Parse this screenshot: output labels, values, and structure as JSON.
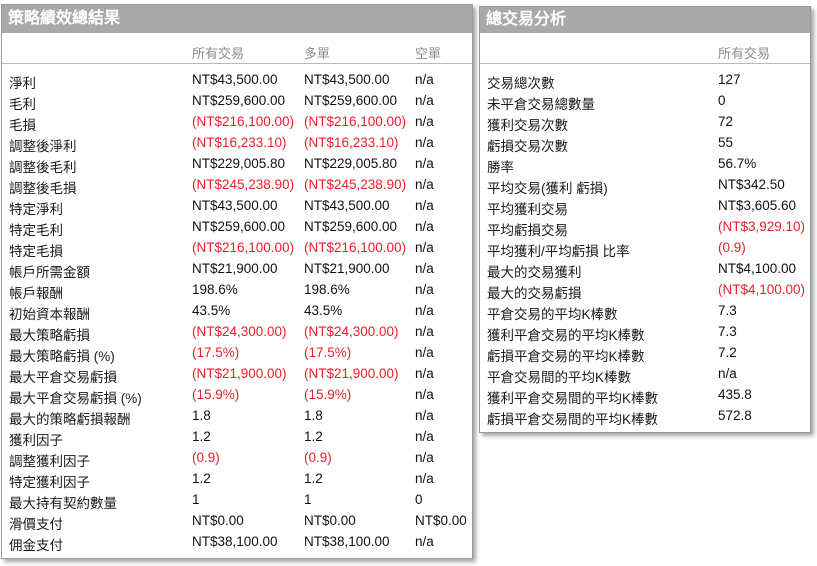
{
  "left_panel": {
    "title": "策略績效總結果",
    "columns": [
      "所有交易",
      "多單",
      "空單"
    ],
    "rows": [
      {
        "label": "淨利",
        "values": [
          "NT$43,500.00",
          "NT$43,500.00",
          "n/a"
        ]
      },
      {
        "label": "毛利",
        "values": [
          "NT$259,600.00",
          "NT$259,600.00",
          "n/a"
        ]
      },
      {
        "label": "毛損",
        "values": [
          "(NT$216,100.00)",
          "(NT$216,100.00)",
          "n/a"
        ]
      },
      {
        "label": "調整後淨利",
        "values": [
          "(NT$16,233.10)",
          "(NT$16,233.10)",
          "n/a"
        ]
      },
      {
        "label": "調整後毛利",
        "values": [
          "NT$229,005.80",
          "NT$229,005.80",
          "n/a"
        ]
      },
      {
        "label": "調整後毛損",
        "values": [
          "(NT$245,238.90)",
          "(NT$245,238.90)",
          "n/a"
        ]
      },
      {
        "label": "特定淨利",
        "values": [
          "NT$43,500.00",
          "NT$43,500.00",
          "n/a"
        ]
      },
      {
        "label": "特定毛利",
        "values": [
          "NT$259,600.00",
          "NT$259,600.00",
          "n/a"
        ]
      },
      {
        "label": "特定毛損",
        "values": [
          "(NT$216,100.00)",
          "(NT$216,100.00)",
          "n/a"
        ]
      },
      {
        "label": "帳戶所需金額",
        "values": [
          "NT$21,900.00",
          "NT$21,900.00",
          "n/a"
        ]
      },
      {
        "label": "帳戶報酬",
        "values": [
          "198.6%",
          "198.6%",
          "n/a"
        ]
      },
      {
        "label": "初始資本報酬",
        "values": [
          "43.5%",
          "43.5%",
          "n/a"
        ]
      },
      {
        "label": "最大策略虧損",
        "values": [
          "(NT$24,300.00)",
          "(NT$24,300.00)",
          "n/a"
        ]
      },
      {
        "label": "最大策略虧損 (%)",
        "values": [
          "(17.5%)",
          "(17.5%)",
          "n/a"
        ]
      },
      {
        "label": "最大平倉交易虧損",
        "values": [
          "(NT$21,900.00)",
          "(NT$21,900.00)",
          "n/a"
        ]
      },
      {
        "label": "最大平倉交易虧損 (%)",
        "values": [
          "(15.9%)",
          "(15.9%)",
          "n/a"
        ]
      },
      {
        "label": "最大的策略虧損報酬",
        "values": [
          "1.8",
          "1.8",
          "n/a"
        ]
      },
      {
        "label": "獲利因子",
        "values": [
          "1.2",
          "1.2",
          "n/a"
        ]
      },
      {
        "label": "調整獲利因子",
        "values": [
          "(0.9)",
          "(0.9)",
          "n/a"
        ]
      },
      {
        "label": "特定獲利因子",
        "values": [
          "1.2",
          "1.2",
          "n/a"
        ]
      },
      {
        "label": "最大持有契約數量",
        "values": [
          "1",
          "1",
          "0"
        ]
      },
      {
        "label": "滑價支付",
        "values": [
          "NT$0.00",
          "NT$0.00",
          "NT$0.00"
        ]
      },
      {
        "label": "佣金支付",
        "values": [
          "NT$38,100.00",
          "NT$38,100.00",
          "n/a"
        ]
      }
    ]
  },
  "right_panel": {
    "title": "總交易分析",
    "columns": [
      "所有交易"
    ],
    "rows": [
      {
        "label": "交易總次數",
        "values": [
          "127"
        ]
      },
      {
        "label": "未平倉交易總數量",
        "values": [
          "0"
        ]
      },
      {
        "label": "獲利交易次數",
        "values": [
          "72"
        ]
      },
      {
        "label": "虧損交易次數",
        "values": [
          "55"
        ]
      },
      {
        "label": "勝率",
        "values": [
          "56.7%"
        ]
      },
      {
        "label": "平均交易(獲利 虧損)",
        "values": [
          "NT$342.50"
        ]
      },
      {
        "label": "平均獲利交易",
        "values": [
          "NT$3,605.60"
        ]
      },
      {
        "label": "平均虧損交易",
        "values": [
          "(NT$3,929.10)"
        ]
      },
      {
        "label": "平均獲利/平均虧損 比率",
        "values": [
          "(0.9)"
        ]
      },
      {
        "label": "最大的交易獲利",
        "values": [
          "NT$4,100.00"
        ]
      },
      {
        "label": "最大的交易虧損",
        "values": [
          "(NT$4,100.00)"
        ]
      },
      {
        "label": "平倉交易的平均K棒數",
        "values": [
          "7.3"
        ]
      },
      {
        "label": "獲利平倉交易的平均K棒數",
        "values": [
          "7.3"
        ]
      },
      {
        "label": "虧損平倉交易的平均K棒數",
        "values": [
          "7.2"
        ]
      },
      {
        "label": "平倉交易間的平均K棒數",
        "values": [
          "n/a"
        ]
      },
      {
        "label": "獲利平倉交易間的平均K棒數",
        "values": [
          "435.8"
        ]
      },
      {
        "label": "虧損平倉交易間的平均K棒數",
        "values": [
          "572.8"
        ]
      }
    ]
  },
  "colors": {
    "negative": "#e8222a",
    "header_bg": "#a9a9a9",
    "column_header": "#8c8c8c"
  }
}
